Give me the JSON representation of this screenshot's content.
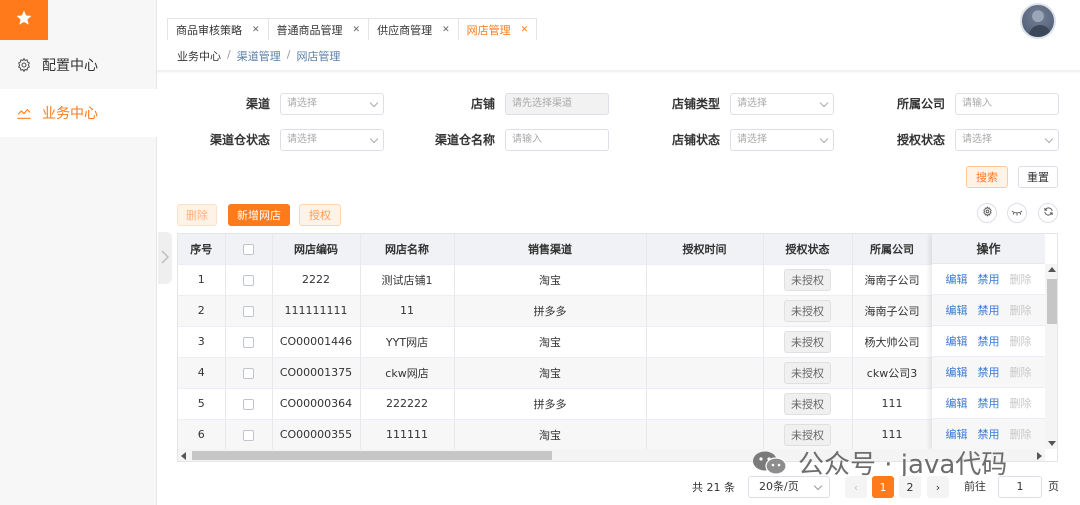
{
  "sidebar": {
    "logo_icon": "star-icon",
    "items": [
      {
        "label": "配置中心",
        "icon": "gear-icon",
        "active": false
      },
      {
        "label": "业务中心",
        "icon": "chart-icon",
        "active": true
      }
    ]
  },
  "tabs": [
    {
      "label": "商品审核策略",
      "active": false
    },
    {
      "label": "普通商品管理",
      "active": false
    },
    {
      "label": "供应商管理",
      "active": false
    },
    {
      "label": "网店管理",
      "active": true
    }
  ],
  "breadcrumb": [
    "业务中心",
    "渠道管理",
    "网店管理"
  ],
  "filters": {
    "channel": {
      "label": "渠道",
      "placeholder": "请选择"
    },
    "shop": {
      "label": "店铺",
      "placeholder": "请先选择渠道"
    },
    "shop_type": {
      "label": "店铺类型",
      "placeholder": "请选择"
    },
    "company": {
      "label": "所属公司",
      "placeholder": "请输入"
    },
    "warehouse_status": {
      "label": "渠道仓状态",
      "placeholder": "请选择"
    },
    "warehouse_name": {
      "label": "渠道仓名称",
      "placeholder": "请输入"
    },
    "shop_status": {
      "label": "店铺状态",
      "placeholder": "请选择"
    },
    "auth_status": {
      "label": "授权状态",
      "placeholder": "请选择"
    }
  },
  "actions": {
    "search": "搜索",
    "reset": "重置",
    "delete": "删除",
    "new_shop": "新增网店",
    "authorize": "授权"
  },
  "table": {
    "columns": [
      "序号",
      "",
      "网店编码",
      "网店名称",
      "销售渠道",
      "授权时间",
      "授权状态",
      "所属公司"
    ],
    "op_header": "操作",
    "rows": [
      {
        "no": "1",
        "code": "2222",
        "name": "测试店铺1",
        "channel": "淘宝",
        "auth_time": "",
        "auth_status": "未授权",
        "company": "海南子公司"
      },
      {
        "no": "2",
        "code": "111111111",
        "name": "11",
        "channel": "拼多多",
        "auth_time": "",
        "auth_status": "未授权",
        "company": "海南子公司"
      },
      {
        "no": "3",
        "code": "CO00001446",
        "name": "YYT网店",
        "channel": "淘宝",
        "auth_time": "",
        "auth_status": "未授权",
        "company": "杨大帅公司"
      },
      {
        "no": "4",
        "code": "CO00001375",
        "name": "ckw网店",
        "channel": "淘宝",
        "auth_time": "",
        "auth_status": "未授权",
        "company": "ckw公司3"
      },
      {
        "no": "5",
        "code": "CO00000364",
        "name": "222222",
        "channel": "拼多多",
        "auth_time": "",
        "auth_status": "未授权",
        "company": "111"
      },
      {
        "no": "6",
        "code": "CO00000355",
        "name": "111111",
        "channel": "淘宝",
        "auth_time": "",
        "auth_status": "未授权",
        "company": "111"
      }
    ],
    "ops": {
      "edit": "编辑",
      "disable": "禁用",
      "remove": "删除"
    }
  },
  "watermark": "公众号 · java代码",
  "pagination": {
    "total": "共 21 条",
    "page_size": "20条/页",
    "pages": [
      "1",
      "2"
    ],
    "current": "1",
    "goto_label": "前往",
    "goto_value": "1",
    "page_suffix": "页"
  },
  "colors": {
    "accent": "#ff7a1a",
    "link": "#3a7bd5"
  }
}
